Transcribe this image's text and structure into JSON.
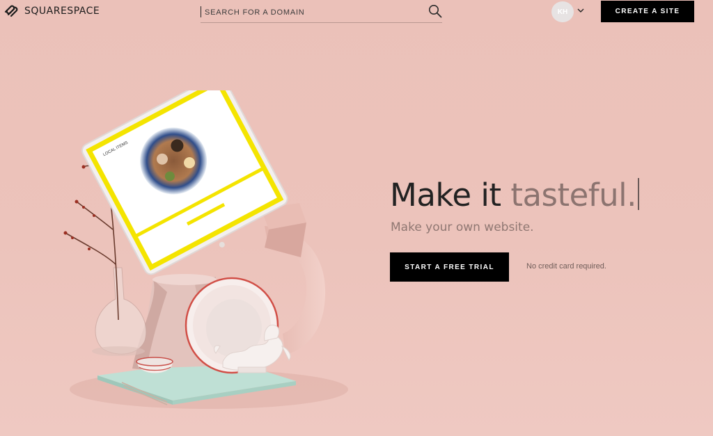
{
  "brand": {
    "name": "SQUARESPACE"
  },
  "header": {
    "search_placeholder": "SEARCH FOR A DOMAIN",
    "avatar_initials": "KH",
    "create_site_label": "CREATE A SITE"
  },
  "hero": {
    "title_dark": "Make it",
    "title_light": "tasteful.",
    "subtitle": "Make your own website.",
    "cta_label": "START A FREE TRIAL",
    "cta_note": "No credit card required."
  },
  "illustration": {
    "tablet_heading": "LOCAL ITEMS"
  },
  "colors": {
    "background": "#ecc1b9",
    "button": "#000000",
    "title_accent": "#8c7470",
    "tablet_frame": "#f4e400"
  }
}
